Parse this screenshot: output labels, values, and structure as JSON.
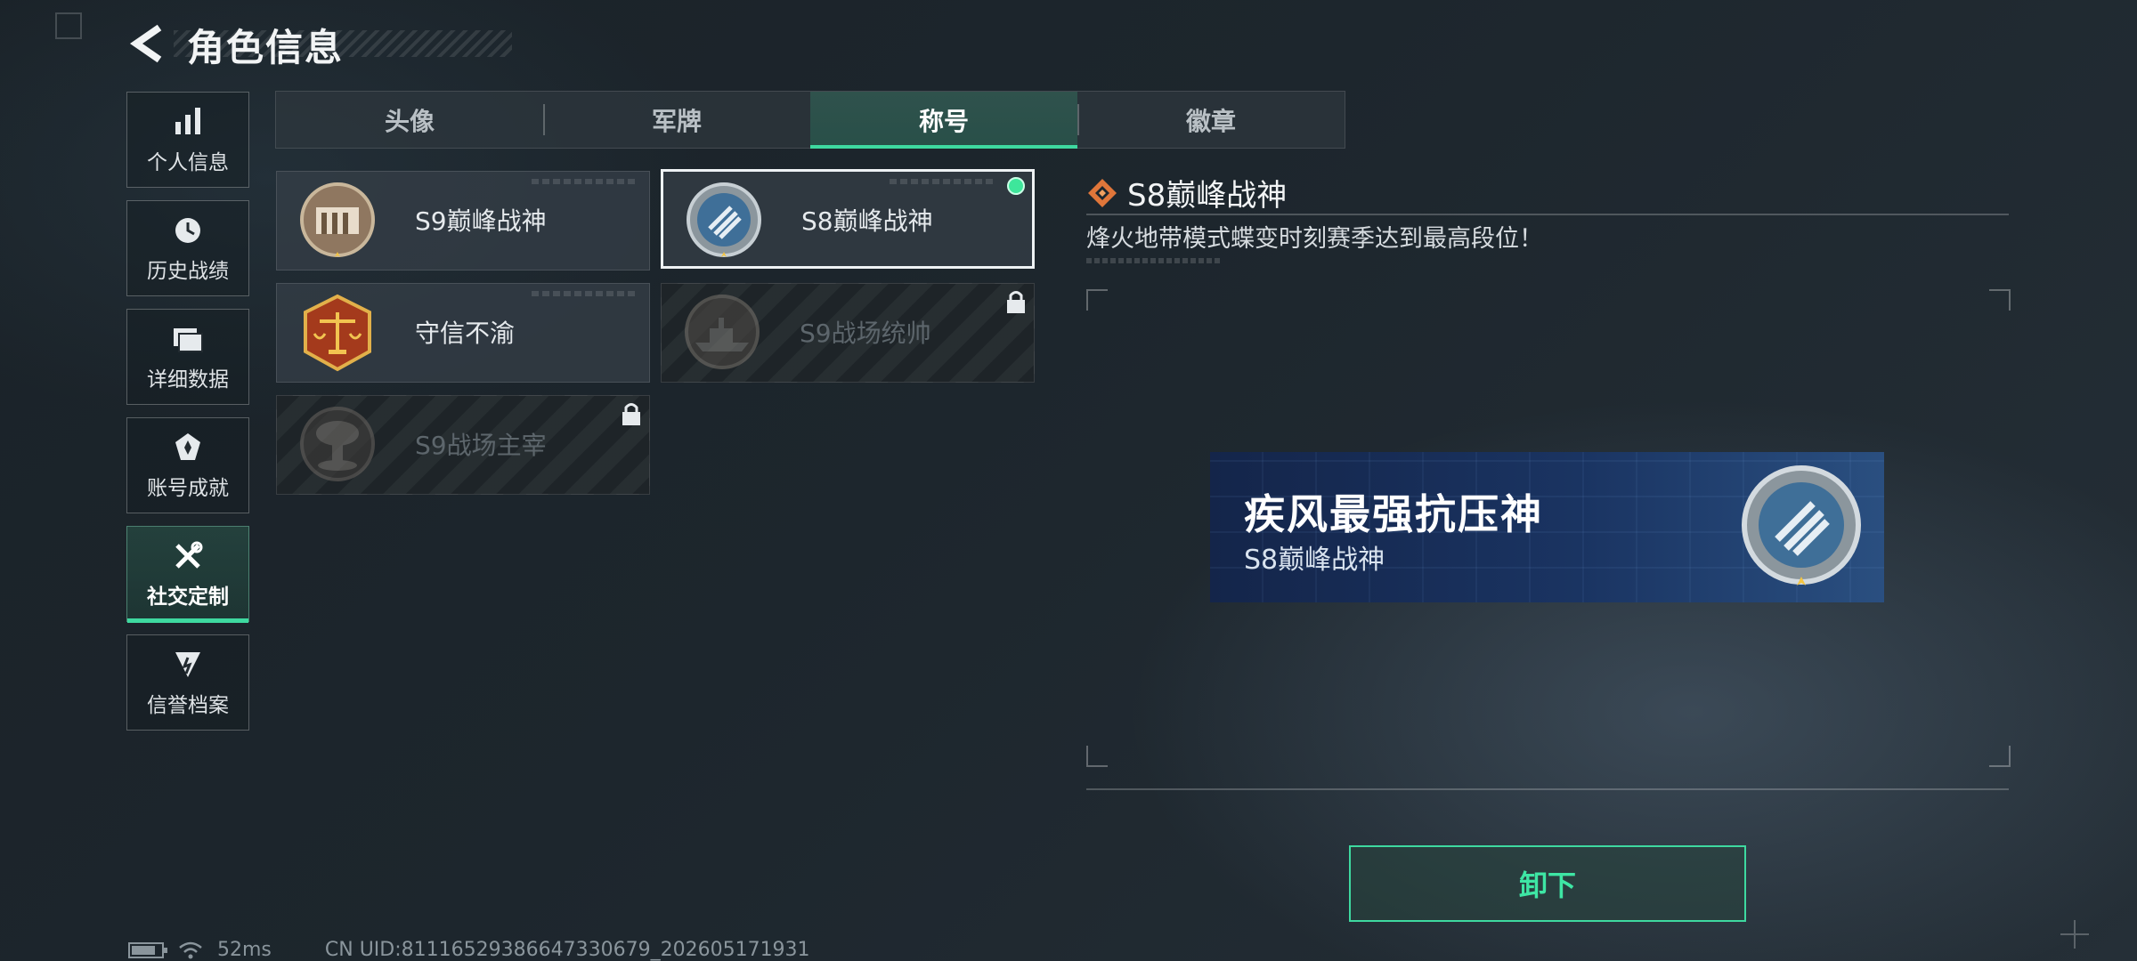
{
  "header": {
    "title": "角色信息"
  },
  "nav": {
    "items": [
      {
        "label": "个人信息",
        "icon": "bar-chart-icon"
      },
      {
        "label": "历史战绩",
        "icon": "history-clock-icon"
      },
      {
        "label": "详细数据",
        "icon": "folders-icon"
      },
      {
        "label": "账号成就",
        "icon": "achievement-badge-icon"
      },
      {
        "label": "社交定制",
        "icon": "tools-wrench-icon",
        "active": true
      },
      {
        "label": "信誉档案",
        "icon": "credit-shield-icon"
      }
    ]
  },
  "tabs": [
    {
      "label": "头像"
    },
    {
      "label": "军牌"
    },
    {
      "label": "称号",
      "active": true
    },
    {
      "label": "徽章"
    }
  ],
  "titles": [
    {
      "label": "S9巅峰战神",
      "icon": "fortress-emblem-icon",
      "locked": false
    },
    {
      "label": "S8巅峰战神",
      "icon": "laurel-blue-emblem-icon",
      "locked": false,
      "selected": true,
      "equipped": true
    },
    {
      "label": "守信不渝",
      "icon": "scales-emblem-icon",
      "locked": false
    },
    {
      "label": "S9战场统帅",
      "icon": "warship-emblem-icon",
      "locked": true
    },
    {
      "label": "S9战场主宰",
      "icon": "mushroom-cloud-emblem-icon",
      "locked": true
    }
  ],
  "detail": {
    "title": "S8巅峰战神",
    "description": "烽火地带模式蝶变时刻赛季达到最高段位！",
    "banner_name": "疾风最强抗压神",
    "banner_sub": "S8巅峰战神"
  },
  "actions": {
    "unequip_label": "卸下"
  },
  "status": {
    "ping": "52ms",
    "uid": "CN UID:81116529386647330679_202605171931"
  },
  "colors": {
    "accent": "#3ed9a0",
    "equipped": "#3ee69b"
  }
}
